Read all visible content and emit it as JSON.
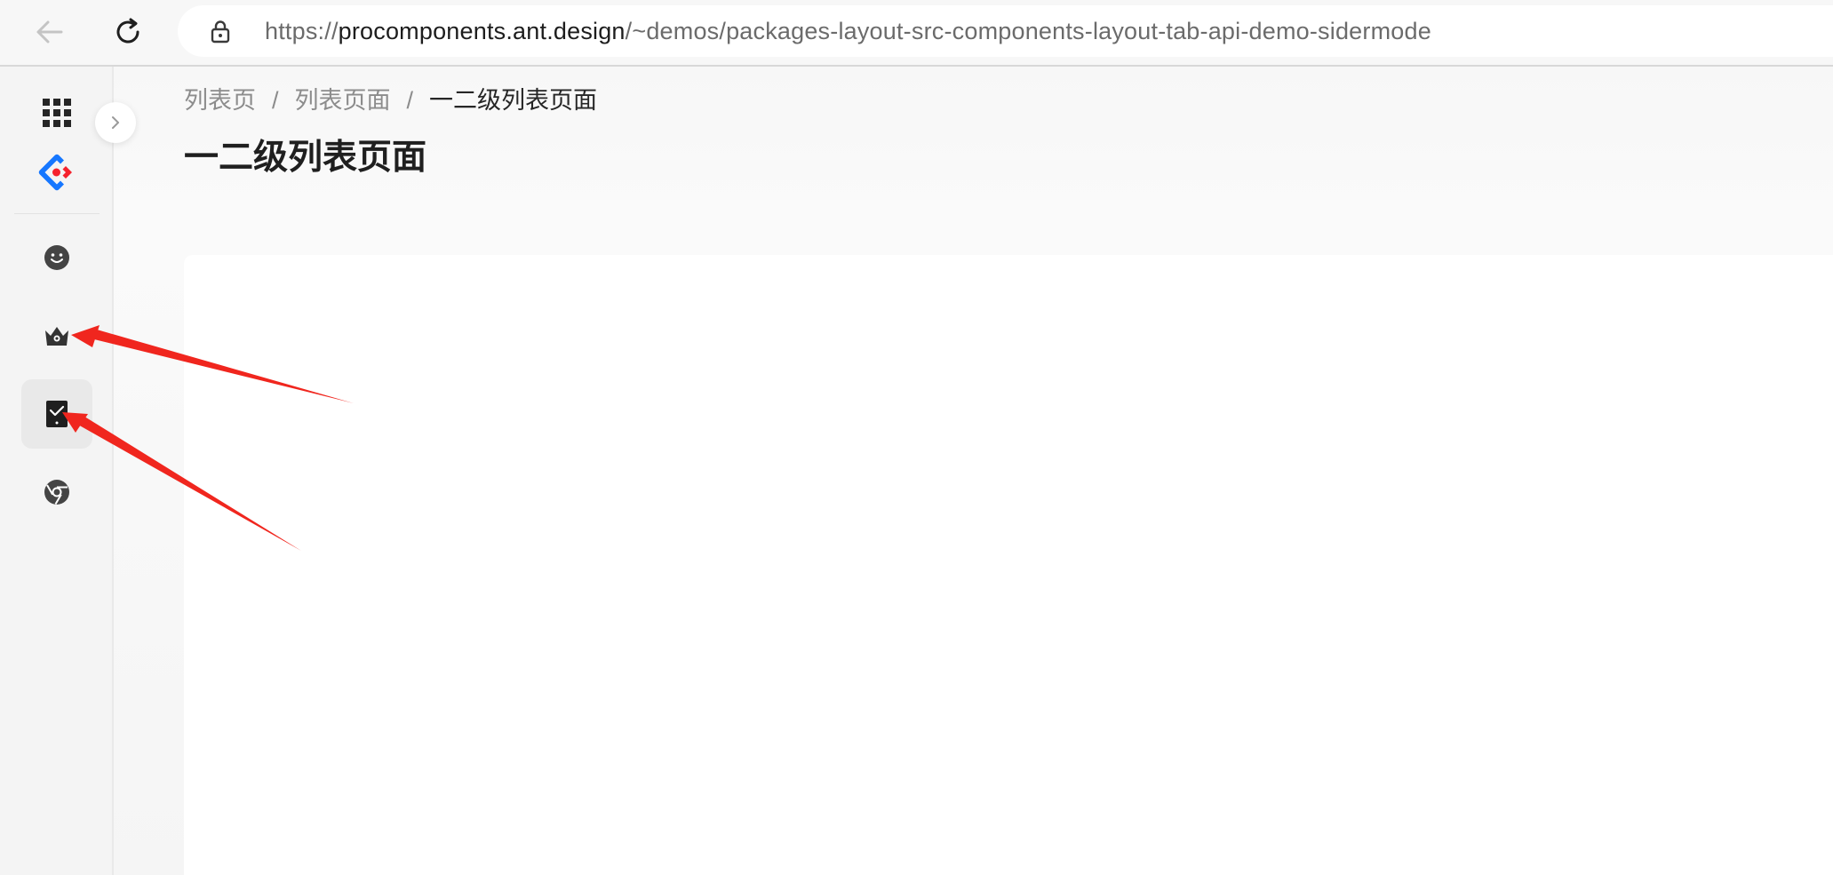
{
  "browser": {
    "url_prefix": "https://",
    "url_host": "procomponents.ant.design",
    "url_path": "/~demos/packages-layout-src-components-layout-tab-api-demo-sidermode"
  },
  "breadcrumb": {
    "items": [
      "列表页",
      "列表页面",
      "一二级列表页面"
    ],
    "separator": "/"
  },
  "page": {
    "title": "一二级列表页面"
  },
  "sider": {
    "icons": [
      "apps-grid-icon",
      "ant-design-logo",
      "smile-icon",
      "crown-icon",
      "tablet-icon",
      "chrome-icon"
    ],
    "selected": "tablet-icon"
  },
  "colors": {
    "annotation_arrow": "#f0261e",
    "brand_blue": "#1677ff",
    "brand_red": "#f5222d"
  }
}
